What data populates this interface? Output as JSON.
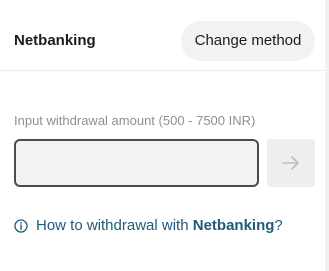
{
  "header": {
    "method_title": "Netbanking",
    "change_button_label": "Change method"
  },
  "withdrawal": {
    "amount_label": "Input withdrawal amount (500 - 7500 INR)",
    "amount_value": "",
    "submit_icon": "arrow-right-icon"
  },
  "help": {
    "icon": "info-icon",
    "text_prefix": "How to withdrawal with ",
    "text_method": "Netbanking",
    "text_suffix": "?"
  },
  "colors": {
    "link": "#1f5a7a",
    "input_border": "#4b4b4b",
    "input_background": "#f1f2f4",
    "disabled_button": "#eeeeef",
    "label_gray": "#8f8f8f"
  }
}
